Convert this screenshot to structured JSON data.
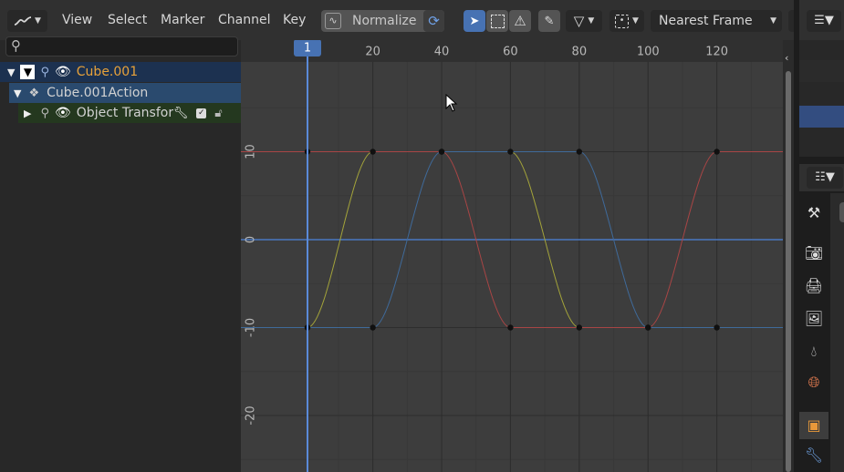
{
  "header": {
    "menus": [
      "View",
      "Select",
      "Marker",
      "Channel",
      "Key"
    ],
    "normalize_label": "Normalize",
    "snap_mode": "Nearest Frame"
  },
  "channels": {
    "items": [
      {
        "label": "Cube.001",
        "level": 0,
        "color": "#e8a23a"
      },
      {
        "label": "Cube.001Action",
        "level": 1,
        "color": "#d2d2d2"
      },
      {
        "label": "Object Transform",
        "level": 2,
        "color": "#d2d2d2"
      }
    ]
  },
  "graph": {
    "current_frame": "1",
    "frame_ticks": [
      "20",
      "40",
      "60",
      "80",
      "100",
      "120"
    ],
    "value_ticks": [
      "10",
      "0",
      "-10",
      "-20"
    ]
  },
  "chart_data": {
    "type": "line",
    "xlabel": "",
    "ylabel": "",
    "xlim": [
      -18,
      131
    ],
    "ylim": [
      -27,
      20
    ],
    "series": [
      {
        "color": "#a3a33a",
        "x": [
          1,
          20,
          60,
          80,
          120
        ],
        "y": [
          -10,
          10,
          10,
          -10,
          -10
        ]
      },
      {
        "color": "#3f6a9a",
        "x": [
          1,
          20,
          40,
          80,
          100
        ],
        "y": [
          -10,
          -10,
          10,
          10,
          -10
        ]
      },
      {
        "color": "#a84545",
        "x": [
          1,
          40,
          60,
          100,
          120
        ],
        "y": [
          10,
          10,
          -10,
          -10,
          10
        ]
      }
    ],
    "grid": true
  },
  "colors": {
    "accent": "#4772b3",
    "x_channel": "#a84545",
    "y_channel": "#a3a33a",
    "z_channel": "#3f6a9a"
  }
}
